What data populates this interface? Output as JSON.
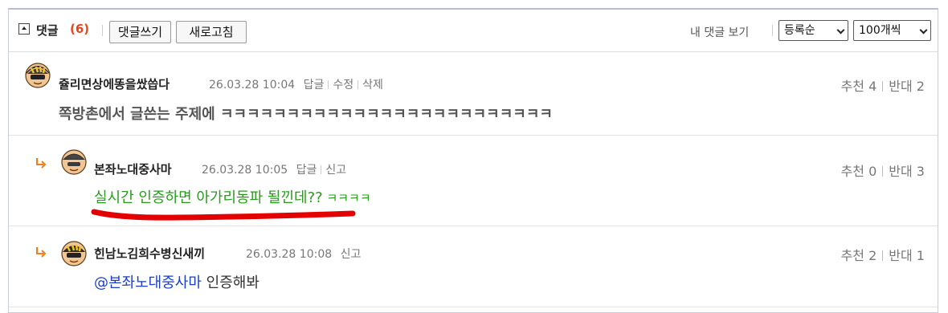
{
  "header": {
    "title": "댓글",
    "count": "(6)",
    "write_button": "댓글쓰기",
    "refresh_button": "새로고침",
    "my_comments": "내 댓글 보기",
    "sort_select": "등록순",
    "per_page_select": "100개씩"
  },
  "comments": [
    {
      "nickname": "쥴리면상에똥을쌌씁다",
      "date": "26.03.28 10:04",
      "actions": [
        "답글",
        "수정",
        "삭제"
      ],
      "upvote": "추천 4",
      "downvote": "반대 2",
      "text": "쪽방촌에서 글쓴는 주제에 ㅋㅋㅋㅋㅋㅋㅋㅋㅋㅋㅋㅋㅋㅋㅋㅋㅋㅋㅋㅋㅋㅋㅋㅋㅋ"
    },
    {
      "nickname": "본좌노대중사마",
      "date": "26.03.28 10:05",
      "actions": [
        "답글",
        "신고"
      ],
      "upvote": "추천 0",
      "downvote": "반대 3",
      "text_main": "실시간 인증하면 아가리동파 될낀데??",
      "text_tail": " ㅋㅋㅋㅋ"
    },
    {
      "nickname": "힌남노김희수병신새끼",
      "date": "26.03.28 10:08",
      "actions": [
        "신고"
      ],
      "upvote": "추천 2",
      "downvote": "반대 1",
      "mention": "@본좌노대중사마",
      "text": " 인증해봐"
    }
  ],
  "colors": {
    "count": "#e8441a",
    "reply_green": "#2a9a1e",
    "mention_blue": "#1a3ec8",
    "underline_red": "#e40000",
    "reply_arrow": "#f07d1a"
  }
}
